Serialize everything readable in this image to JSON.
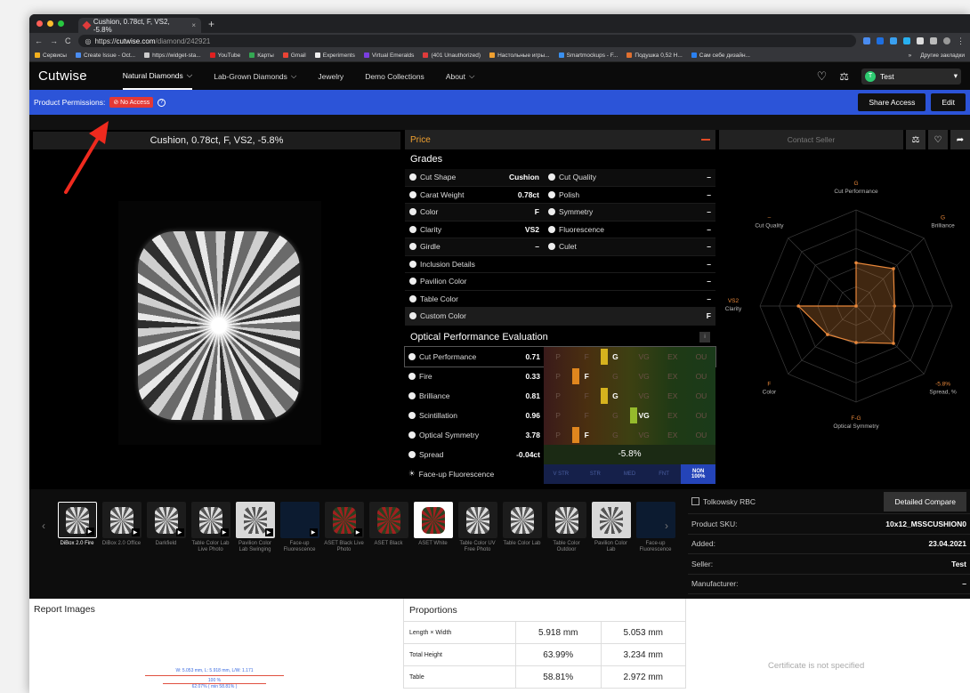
{
  "browser": {
    "tab_title": "Cushion, 0.78ct, F, VS2, -5.8%",
    "url_scheme": "https://",
    "url_host": "cutwise.com",
    "url_path": "/diamond/242921",
    "bookmarks": [
      "Сервисы",
      "Create Issue - Oct...",
      "https://widget-sta...",
      "YouTube",
      "Карты",
      "Gmail",
      "Experiments",
      "Virtual Emeralds",
      "(401 Unauthorized)",
      "Настольные игры...",
      "Smartmockups - F...",
      "Подушка 0,52 Н...",
      "Сам себе дизайн..."
    ],
    "bookmarks_right": [
      "»",
      "Другие закладки"
    ]
  },
  "nav": {
    "logo": "Cutwise",
    "items": [
      "Natural Diamonds",
      "Lab-Grown Diamonds",
      "Jewelry",
      "Demo Collections",
      "About"
    ],
    "user": "Test",
    "user_initial": "T"
  },
  "permissions": {
    "label": "Product Permissions:",
    "badge": "No Access",
    "share": "Share Access",
    "edit": "Edit"
  },
  "product": {
    "title": "Cushion, 0.78ct, F, VS2, -5.8%"
  },
  "price": {
    "label": "Price"
  },
  "grades": {
    "title": "Grades",
    "rows": [
      {
        "l": "Cut Shape",
        "lv": "Cushion",
        "r": "Cut Quality",
        "rv": "–"
      },
      {
        "l": "Carat Weight",
        "lv": "0.78ct",
        "r": "Polish",
        "rv": "–"
      },
      {
        "l": "Color",
        "lv": "F",
        "r": "Symmetry",
        "rv": "–"
      },
      {
        "l": "Clarity",
        "lv": "VS2",
        "r": "Fluorescence",
        "rv": "–"
      },
      {
        "l": "Girdle",
        "lv": "–",
        "r": "Culet",
        "rv": "–"
      }
    ],
    "single": [
      {
        "l": "Inclusion Details",
        "v": "–"
      },
      {
        "l": "Pavilion Color",
        "v": "–"
      },
      {
        "l": "Table Color",
        "v": "–"
      },
      {
        "l": "Custom Color",
        "v": "F"
      }
    ]
  },
  "optical": {
    "title": "Optical Performance Evaluation",
    "info": "i",
    "scale": [
      "P",
      "F",
      "G",
      "VG",
      "EX",
      "OU"
    ],
    "rows": [
      {
        "l": "Cut Performance",
        "v": "0.71",
        "on": 2
      },
      {
        "l": "Fire",
        "v": "0.33",
        "on": 1
      },
      {
        "l": "Brilliance",
        "v": "0.81",
        "on": 2
      },
      {
        "l": "Scintillation",
        "v": "0.96",
        "on": 3
      },
      {
        "l": "Optical Symmetry",
        "v": "3.78",
        "on": 1
      }
    ],
    "spread": {
      "l": "Spread",
      "v": "-0.04ct",
      "bar": "-5.8%"
    },
    "fluor": {
      "l": "Face-up Fluorescence",
      "scale": [
        "V STR",
        "STR",
        "MED",
        "FNT"
      ],
      "active": "NON",
      "active_sub": "100%"
    }
  },
  "right": {
    "contact": "Contact Seller",
    "radar_labels": [
      {
        "name": "Cut Performance",
        "grade": "G"
      },
      {
        "name": "Brilliance",
        "grade": "G"
      },
      {
        "name": "Fire",
        "grade": "F"
      },
      {
        "name": "Spread, %",
        "grade": "-5.8%"
      },
      {
        "name": "Optical Symmetry",
        "grade": "F-G"
      },
      {
        "name": "Color",
        "grade": "F"
      },
      {
        "name": "Clarity",
        "grade": "VS2"
      },
      {
        "name": "Cut Quality",
        "grade": "–"
      }
    ]
  },
  "chart_data": {
    "type": "radar",
    "axes": [
      "Cut Performance",
      "Brilliance",
      "Fire",
      "Spread, %",
      "Optical Symmetry",
      "Color",
      "Clarity",
      "Cut Quality"
    ],
    "values": [
      0.45,
      0.55,
      0.4,
      0.55,
      0.38,
      0.42,
      0.6,
      0
    ]
  },
  "thumbs": [
    {
      "cap": "DiBox 2.0 Fire",
      "sel": true,
      "play": true
    },
    {
      "cap": "DiBox 2.0 Office",
      "play": true
    },
    {
      "cap": "Darkfield",
      "play": true
    },
    {
      "cap": "Table Color Lab Live Photo",
      "play": true
    },
    {
      "cap": "Pavilion Color Lab Swinging",
      "play": true
    },
    {
      "cap": "Face-up Fluorescence",
      "play": true
    },
    {
      "cap": "ASET Black Live Photo",
      "play": true
    },
    {
      "cap": "ASET Black"
    },
    {
      "cap": "ASET White"
    },
    {
      "cap": "Table Color UV Free Photo"
    },
    {
      "cap": "Table Color Lab"
    },
    {
      "cap": "Table Color Outdoor"
    },
    {
      "cap": "Pavilion Color Lab"
    },
    {
      "cap": "Face-up Fluorescence"
    }
  ],
  "info": {
    "tolkowsky": "Tolkowsky RBC",
    "compare": "Detailed Compare",
    "rows": [
      {
        "l": "Product SKU:",
        "v": "10x12_MSSCUSHION0"
      },
      {
        "l": "Added:",
        "v": "23.04.2021"
      },
      {
        "l": "Seller:",
        "v": "Test"
      },
      {
        "l": "Manufacturer:",
        "v": "–"
      }
    ]
  },
  "report": {
    "title": "Report Images",
    "ruler_top": "W: 5.053 mm, L: 5.918 mm, L/W: 1.171",
    "ruler_mid": "100 %",
    "ruler_bot": "62.07% ( min 58.81% )"
  },
  "proportions": {
    "title": "Proportions",
    "rows": [
      {
        "l": "Length × Width",
        "a": "5.918 mm",
        "b": "5.053 mm"
      },
      {
        "l": "Total Height",
        "a": "63.99%",
        "b": "3.234 mm"
      },
      {
        "l": "Table",
        "a": "58.81%",
        "b": "2.972 mm"
      }
    ]
  },
  "certificate": "Certificate is not specified"
}
